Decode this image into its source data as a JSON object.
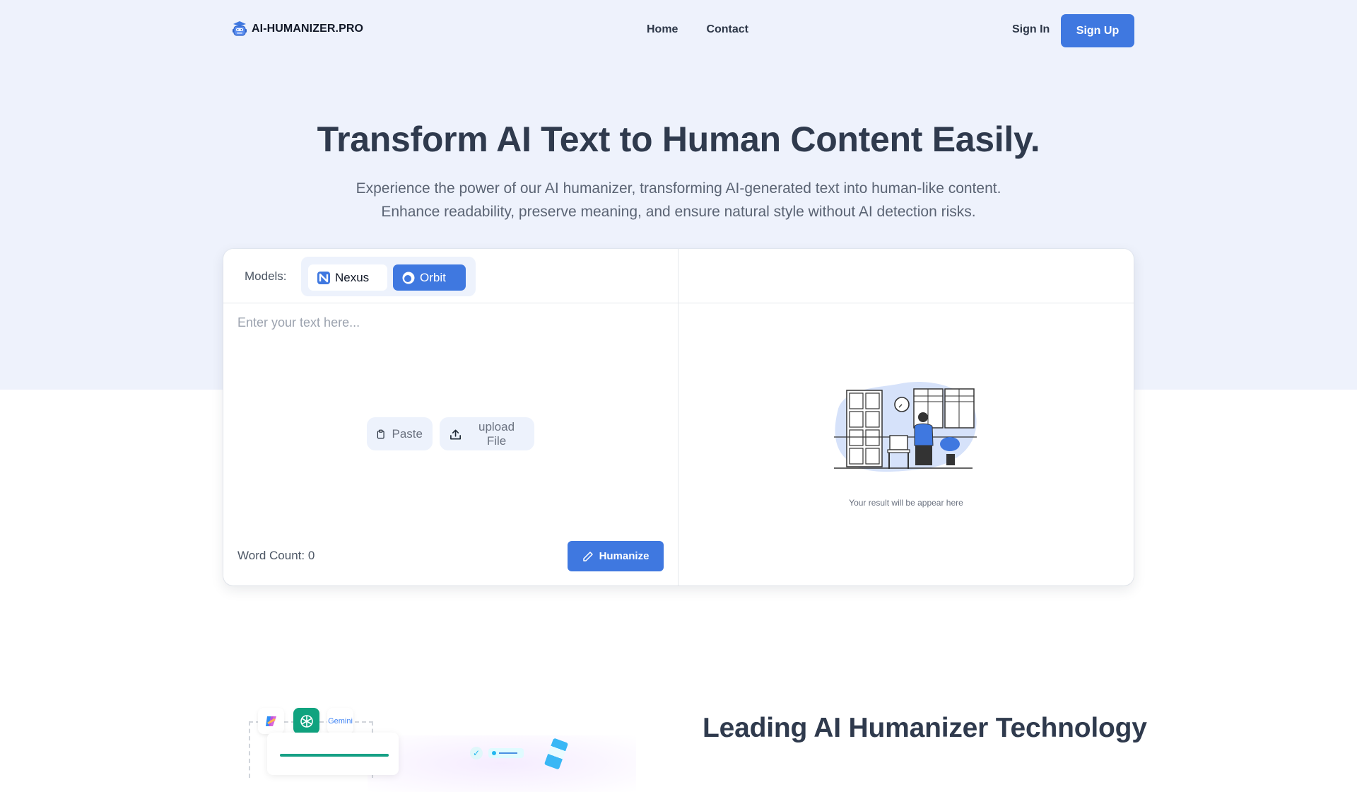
{
  "brand": {
    "name": "AI-HUMANIZER.PRO",
    "logo_icon": "robot-graduate-icon",
    "accent": "#3f78e0"
  },
  "nav": {
    "links": [
      {
        "label": "Home"
      },
      {
        "label": "Contact"
      }
    ],
    "sign_in": "Sign In",
    "sign_up": "Sign Up"
  },
  "hero": {
    "title": "Transform AI Text to Human Content Easily.",
    "subtitle_line1": "Experience the power of our AI humanizer, transforming AI-generated text into human-like content.",
    "subtitle_line2": "Enhance readability, preserve meaning, and ensure natural style without AI detection risks."
  },
  "editor": {
    "models_label": "Models:",
    "models": [
      {
        "name": "Nexus",
        "icon": "nexus-logo-icon",
        "selected": false
      },
      {
        "name": "Orbit",
        "icon": "orbit-logo-icon",
        "selected": true
      }
    ],
    "input_placeholder": "Enter your text here...",
    "input_value": "",
    "paste_label": "Paste",
    "upload_label": "upload File",
    "word_count_label": "Word Count: 0",
    "humanize_label": "Humanize"
  },
  "result": {
    "placeholder_text": "Your result will be appear here",
    "illustration": "waiting-room-illustration"
  },
  "features": {
    "title": "Leading AI Humanizer Technology",
    "ai_logos": [
      "Copilot",
      "ChatGPT",
      "Gemini"
    ]
  }
}
